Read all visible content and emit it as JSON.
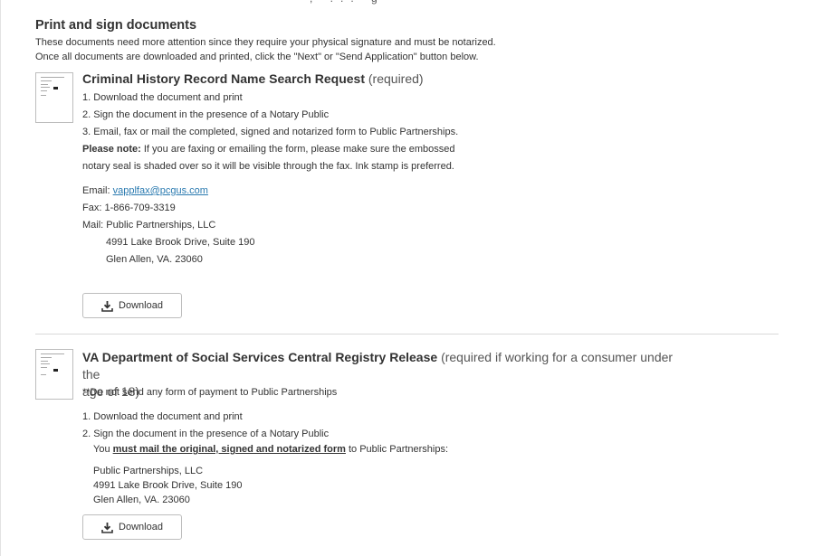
{
  "section": {
    "title": "Print and sign documents",
    "intro_line1": "These documents need more attention since they require your physical signature and must be notarized.",
    "intro_line2": "Once all documents are downloaded and printed, click the \"Next\" or \"Send Application\" button below."
  },
  "doc1": {
    "title": "Criminal History Record Name Search Request",
    "requirement": "(required)",
    "steps": [
      "1. Download the document and print",
      "2. Sign the document in the presence of a Notary Public",
      "3. Email, fax or mail the completed, signed and notarized form to Public Partnerships."
    ],
    "note_label": "Please note:",
    "note_text": " If you are faxing or emailing the form, please make sure the embossed",
    "note_text2": "notary seal is shaded over so it will be visible through the fax. Ink stamp is preferred.",
    "email_label": "Email: ",
    "email": "vapplfax@pcgus.com",
    "fax": "Fax: 1-866-709-3319",
    "mail_label": "Mail: Public Partnerships, LLC",
    "mail_line2": "4991 Lake Brook Drive, Suite 190",
    "mail_line3": "Glen Allen, VA. 23060",
    "download_label": "Download",
    "download_icon": "download-icon"
  },
  "doc2": {
    "title": "VA Department of Social Services Central Registry Release",
    "requirement_line1": "(required if working for a consumer under the",
    "requirement_line2": "age of 18)",
    "payment_note": "**Do not send any form of payment to Public Partnerships",
    "steps": [
      "1. Download the document and print",
      "2. Sign the document in the presence of a Notary Public"
    ],
    "you": "You ",
    "must_mail": "must mail the original, signed and notarized form",
    "to_pp": " to Public Partnerships:",
    "address1": "Public Partnerships, LLC",
    "address2": "4991 Lake Brook Drive, Suite 190",
    "address3": "Glen Allen, VA. 23060",
    "download_label": "Download",
    "download_icon": "download-icon"
  }
}
